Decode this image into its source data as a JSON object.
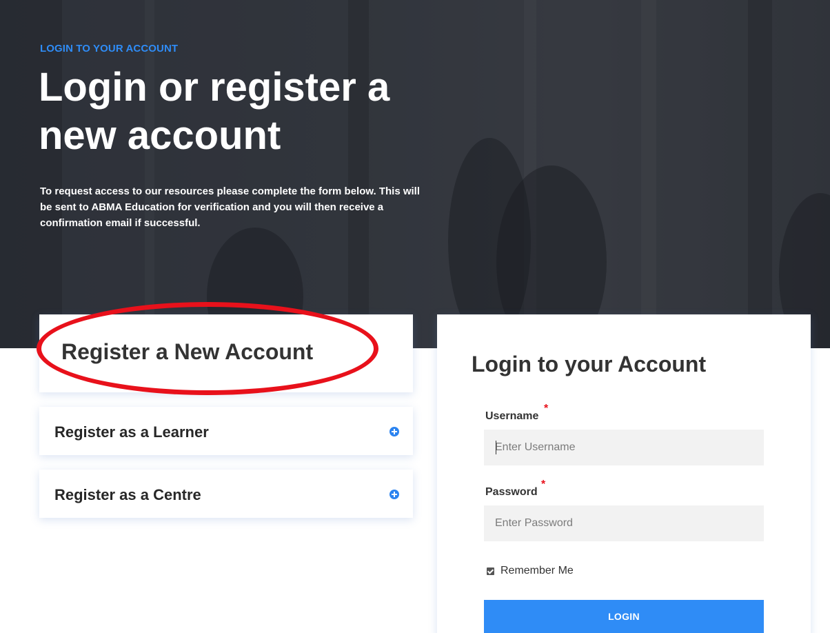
{
  "hero": {
    "eyebrow": "LOGIN TO YOUR ACCOUNT",
    "title": "Login or register a new account",
    "description": "To request access to our resources please complete the form below. This will be sent to ABMA Education for verification and you will then receive a confirmation email if successful."
  },
  "register": {
    "title": "Register a New Account",
    "items": [
      {
        "label": "Register as a Learner",
        "icon": "plus-circle-icon"
      },
      {
        "label": "Register as a Centre",
        "icon": "plus-circle-icon"
      }
    ]
  },
  "login": {
    "title": "Login to your Account",
    "username_label": "Username",
    "username_placeholder": "Enter Username",
    "password_label": "Password",
    "password_placeholder": "Enter Password",
    "required_marker": "*",
    "remember_label": "Remember Me",
    "remember_checked": true,
    "button_label": "LOGIN"
  },
  "colors": {
    "accent": "#2f8cf6",
    "required": "#e8111b",
    "highlight_ring": "#e8111b"
  }
}
